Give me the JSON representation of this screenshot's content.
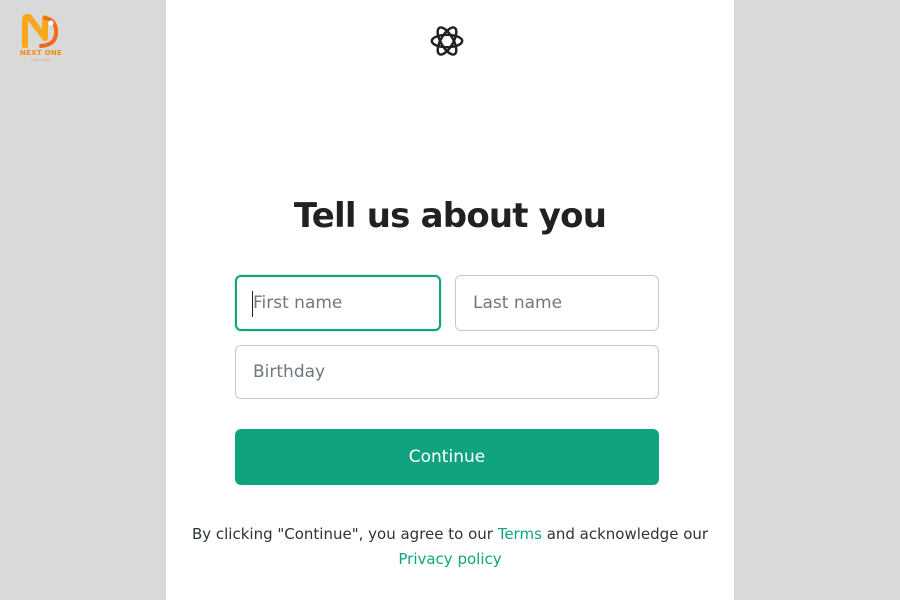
{
  "brand": {
    "name": "NEXT ONE",
    "tagline": "NEXT & NEW",
    "colors": {
      "primary": "#f7a81b",
      "secondary": "#f26b1d"
    }
  },
  "app": {
    "logo_icon": "openai-logo-icon"
  },
  "form": {
    "heading": "Tell us about you",
    "first_name_placeholder": "First name",
    "last_name_placeholder": "Last name",
    "birthday_placeholder": "Birthday",
    "continue_label": "Continue",
    "focused_field": "first_name"
  },
  "legal": {
    "prefix": "By clicking \"Continue\", you agree to our",
    "terms_label": "Terms",
    "middle": "and acknowledge our",
    "privacy_label": "Privacy policy"
  },
  "colors": {
    "accent": "#10a37f",
    "page_background": "#d9d9d9",
    "panel_background": "#ffffff",
    "heading": "#202123",
    "input_border": "#c2c8d0"
  }
}
